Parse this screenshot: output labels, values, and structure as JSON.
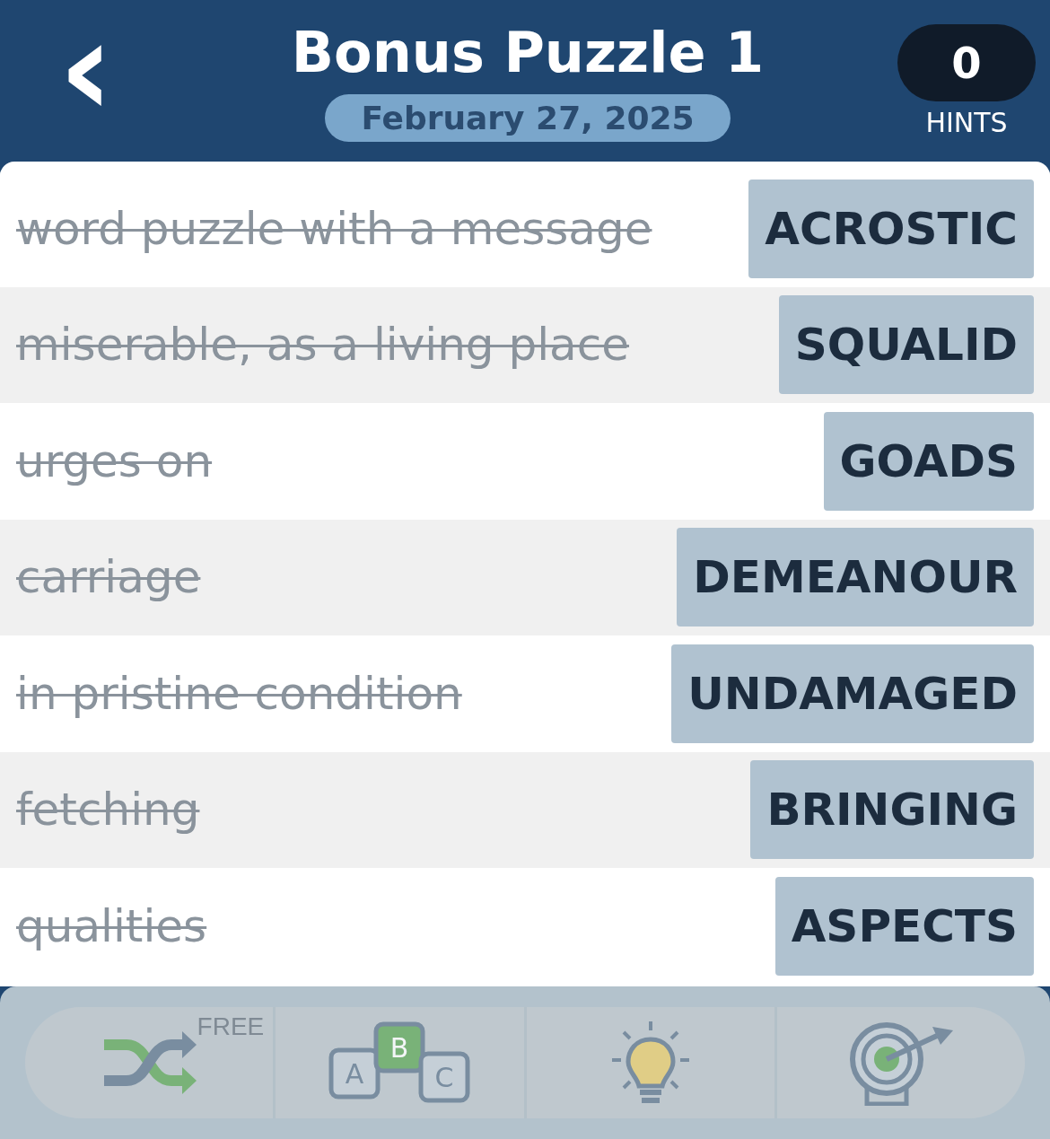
{
  "header": {
    "back": "‹",
    "title": "Bonus Puzzle 1",
    "date": "February 27, 2025",
    "hints": {
      "count": "0",
      "label": "HINTS"
    }
  },
  "clues": [
    {
      "clue": "word puzzle with a message",
      "answer": "ACROSTIC",
      "solved": true
    },
    {
      "clue": "miserable, as a living place",
      "answer": "SQUALID",
      "solved": true
    },
    {
      "clue": "urges on",
      "answer": "GOADS",
      "solved": true
    },
    {
      "clue": "carriage",
      "answer": "DEMEANOUR",
      "solved": true
    },
    {
      "clue": "in pristine condition",
      "answer": "UNDAMAGED",
      "solved": true
    },
    {
      "clue": "fetching",
      "answer": "BRINGING",
      "solved": true
    },
    {
      "clue": "qualities",
      "answer": "ASPECTS",
      "solved": true
    }
  ],
  "toolbar": {
    "disabled": true,
    "tools": [
      {
        "kind": "shuffle",
        "badge": "FREE"
      },
      {
        "kind": "letters",
        "letters": [
          "A",
          "B",
          "C"
        ]
      },
      {
        "kind": "hint"
      },
      {
        "kind": "target"
      }
    ]
  }
}
